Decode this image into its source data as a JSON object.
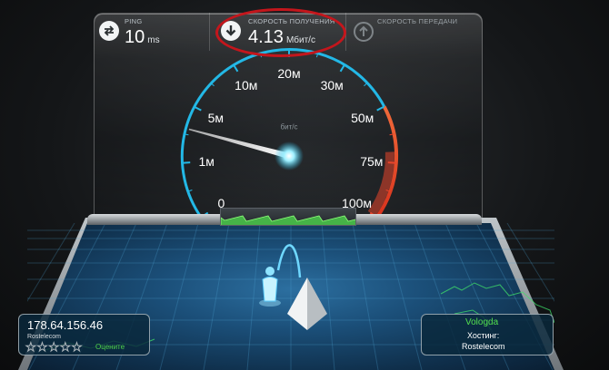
{
  "stats": {
    "ping": {
      "label": "PING",
      "value": "10",
      "unit": "ms",
      "icon": "ping-arrows-icon"
    },
    "download": {
      "label": "СКОРОСТЬ ПОЛУЧЕНИЯ",
      "value": "4.13",
      "unit": "Мбит/с",
      "icon": "download-arrow-icon"
    },
    "upload": {
      "label": "СКОРОСТЬ ПЕРЕДАЧИ",
      "icon": "upload-arrow-icon"
    }
  },
  "gauge": {
    "unit_label": "бит/с",
    "scale_labels": [
      "0",
      "1м",
      "5м",
      "10м",
      "20м",
      "30м",
      "50м",
      "75м",
      "100м"
    ],
    "current_value_mbps": 4.13,
    "needle_label_index": 1.6,
    "colors": {
      "accent": "#23b8e6",
      "hot": "#e8452b",
      "needle": "#ffffff"
    }
  },
  "client": {
    "ip": "178.64.156.46",
    "isp": "Rostelecom",
    "rating_stars": 5,
    "rating_filled": 0,
    "rate_label": "Оцените"
  },
  "server": {
    "city": "Vologda",
    "host_label": "Хостинг:",
    "host": "Rostelecom"
  },
  "annotation": {
    "color": "#c4161c"
  }
}
